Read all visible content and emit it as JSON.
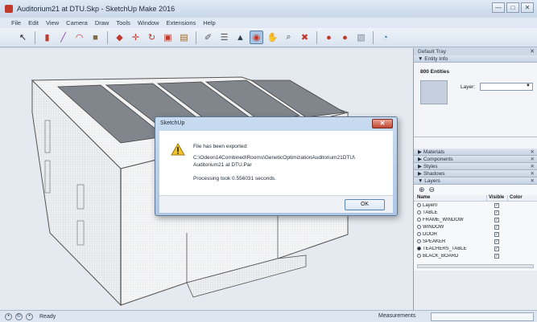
{
  "window": {
    "title": "Auditorium21 at DTU.Skp - SketchUp Make 2016",
    "controls": [
      "—",
      "□",
      "✕"
    ]
  },
  "menu": [
    "File",
    "Edit",
    "View",
    "Camera",
    "Draw",
    "Tools",
    "Window",
    "Extensions",
    "Help"
  ],
  "toolbar": {
    "icons": [
      "select-icon",
      "eraser-icon",
      "line-icon",
      "arc-icon",
      "shape-icon",
      "push-pull-icon",
      "move-icon",
      "rotate-icon",
      "scale-icon",
      "offset-icon",
      "tape-icon",
      "text-icon",
      "paint-icon",
      "orbit-icon",
      "pan-icon",
      "zoom-icon",
      "zoom-extents-icon",
      "warehouse-icon",
      "extension-warehouse-icon",
      "send-to-layout-icon",
      "layout-icon"
    ]
  },
  "tray": {
    "title": "Default Tray",
    "entity_info": {
      "header": "Entity Info",
      "count": "800 Entities",
      "layer_label": "Layer:"
    },
    "sections": [
      "Materials",
      "Components",
      "Styles",
      "Shadows",
      "Layers"
    ],
    "layers": {
      "columns": {
        "name": "Name",
        "visible": "Visible",
        "color": "Color"
      },
      "rows": [
        {
          "name": "Layer0",
          "active": false
        },
        {
          "name": "TABLE",
          "active": false
        },
        {
          "name": "FRAME_WINDOW",
          "active": false
        },
        {
          "name": "WINDOW",
          "active": false
        },
        {
          "name": "DOOR",
          "active": false
        },
        {
          "name": "SPEAKER",
          "active": false
        },
        {
          "name": "TEACHERS_TABLE",
          "active": true
        },
        {
          "name": "BLACK_BOARD",
          "active": false
        }
      ]
    }
  },
  "dialog": {
    "title": "SketchUp",
    "line1": "File has been exported:",
    "line2": "C:\\Odeon14Combined\\Rooms\\GeneticOptimizationAuditorium21DTU\\",
    "line3": "Auditorium21 at DTU.Par",
    "line4": "Processing took 0.556031 seconds.",
    "ok_label": "OK",
    "close_label": "✕"
  },
  "status": {
    "text": "Ready",
    "measurements_label": "Measurements"
  },
  "colors": {
    "accent": "#5b86b8",
    "title_bar": "#c9d8ea",
    "model_face": "#f4f4f4",
    "model_roof": "#7e848b"
  }
}
